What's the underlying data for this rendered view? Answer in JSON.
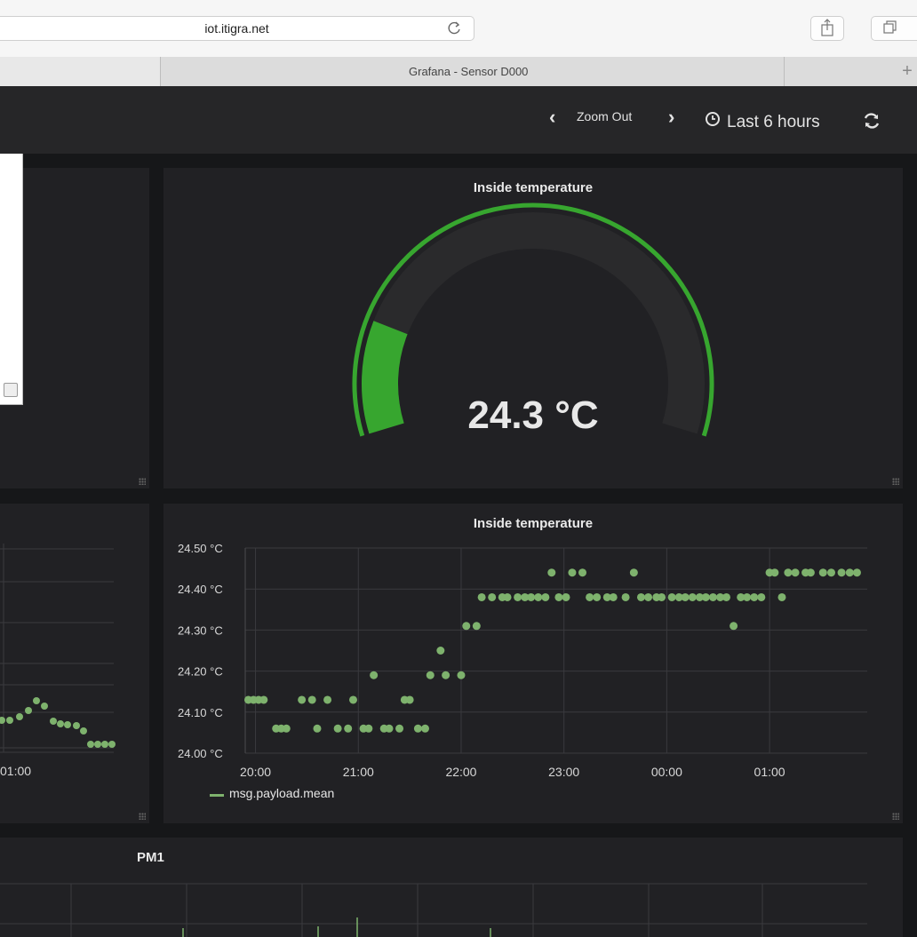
{
  "browser": {
    "url": "iot.itigra.net",
    "tab_title": "Grafana - Sensor D000",
    "new_tab_label": "+"
  },
  "navbar": {
    "zoom_out_label": "Zoom Out",
    "time_range_label": "Last 6 hours",
    "icons": [
      "chevron-left-icon",
      "chevron-right-icon",
      "clock-icon",
      "refresh-icon"
    ]
  },
  "gauge_panel": {
    "title": "Inside temperature",
    "value_text": "24.3 °C",
    "fill_fraction": 0.18,
    "colors": {
      "threshold": "#37a62f",
      "fill": "#37a62f",
      "track": "#2a2a2c"
    }
  },
  "graph_panel": {
    "title": "Inside temperature",
    "legend": "msg.payload.mean",
    "color": "#7eb26d"
  },
  "left_graph_panel": {
    "x_tick": "01:00"
  },
  "pm1_panel": {
    "title": "PM1"
  },
  "chart_data": {
    "type": "scatter",
    "title": "Inside temperature",
    "xlabel": "",
    "ylabel": "",
    "x_ticks": [
      "20:00",
      "21:00",
      "22:00",
      "23:00",
      "00:00",
      "01:00"
    ],
    "y_ticks": [
      "24.00 °C",
      "24.10 °C",
      "24.20 °C",
      "24.30 °C",
      "24.40 °C",
      "24.50 °C"
    ],
    "ylim": [
      24.0,
      24.5
    ],
    "xlim": [
      19.9,
      25.95
    ],
    "grid": true,
    "legend_position": "bottom-left",
    "series": [
      {
        "name": "msg.payload.mean",
        "color": "#7eb26d",
        "x": [
          19.93,
          19.98,
          20.03,
          20.08,
          20.2,
          20.25,
          20.3,
          20.45,
          20.55,
          20.6,
          20.7,
          20.8,
          20.9,
          20.95,
          21.05,
          21.1,
          21.15,
          21.25,
          21.3,
          21.4,
          21.45,
          21.5,
          21.58,
          21.65,
          21.7,
          21.8,
          21.85,
          22.0,
          22.05,
          22.15,
          22.2,
          22.3,
          22.4,
          22.45,
          22.55,
          22.62,
          22.68,
          22.75,
          22.82,
          22.88,
          22.95,
          23.02,
          23.08,
          23.18,
          23.25,
          23.32,
          23.42,
          23.48,
          23.6,
          23.68,
          23.75,
          23.82,
          23.9,
          23.95,
          24.05,
          24.12,
          24.18,
          24.25,
          24.32,
          24.38,
          24.45,
          24.52,
          24.58,
          24.65,
          24.72,
          24.78,
          24.85,
          24.92,
          25.0,
          25.05,
          25.12,
          25.18,
          25.25,
          25.35,
          25.4,
          25.52,
          25.6,
          25.7,
          25.78,
          25.85
        ],
        "y": [
          24.13,
          24.13,
          24.13,
          24.13,
          24.06,
          24.06,
          24.06,
          24.13,
          24.13,
          24.06,
          24.13,
          24.06,
          24.06,
          24.13,
          24.06,
          24.06,
          24.19,
          24.06,
          24.06,
          24.06,
          24.13,
          24.13,
          24.06,
          24.06,
          24.19,
          24.25,
          24.19,
          24.19,
          24.31,
          24.31,
          24.38,
          24.38,
          24.38,
          24.38,
          24.38,
          24.38,
          24.38,
          24.38,
          24.38,
          24.44,
          24.38,
          24.38,
          24.44,
          24.44,
          24.38,
          24.38,
          24.38,
          24.38,
          24.38,
          24.44,
          24.38,
          24.38,
          24.38,
          24.38,
          24.38,
          24.38,
          24.38,
          24.38,
          24.38,
          24.38,
          24.38,
          24.38,
          24.38,
          24.31,
          24.38,
          24.38,
          24.38,
          24.38,
          24.44,
          24.44,
          24.38,
          24.44,
          24.44,
          24.44,
          24.44,
          24.44,
          24.44,
          24.44,
          24.44,
          24.44
        ]
      }
    ]
  }
}
